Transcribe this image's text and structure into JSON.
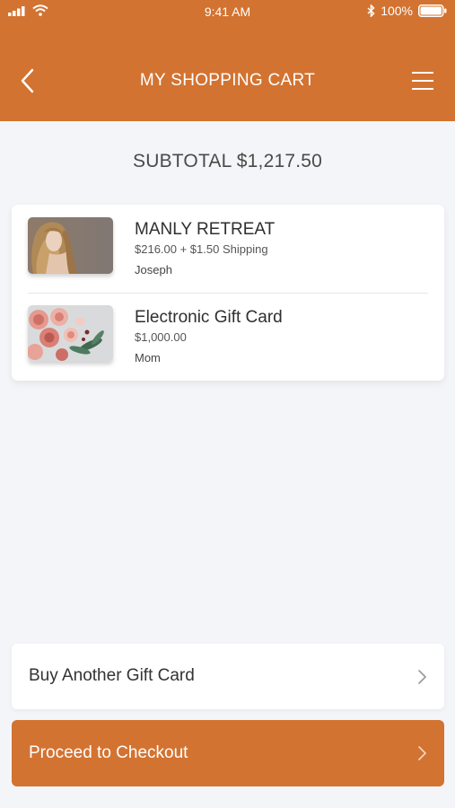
{
  "status_bar": {
    "time": "9:41 AM",
    "battery": "100%",
    "icons": [
      "signal-icon",
      "wifi-icon",
      "bluetooth-icon",
      "battery-icon"
    ]
  },
  "nav": {
    "title": "MY SHOPPING CART",
    "back_icon": "chevron-left-icon",
    "menu_icon": "hamburger-menu-icon"
  },
  "cart": {
    "subtotal": "SUBTOTAL $1,217.50",
    "items": [
      {
        "name": "MANLY RETREAT",
        "price": "$216.00 + $1.50 Shipping",
        "recipient": "Joseph",
        "thumbnail": "woman-portrait-image"
      },
      {
        "name": "Electronic Gift Card",
        "price": "$1,000.00",
        "recipient": "Mom",
        "thumbnail": "flowers-image"
      }
    ]
  },
  "actions": {
    "buy_another": "Buy Another Gift Card",
    "checkout": "Proceed to Checkout"
  },
  "colors": {
    "brand": "#d37331",
    "background": "#f4f5f8",
    "card": "#ffffff"
  }
}
